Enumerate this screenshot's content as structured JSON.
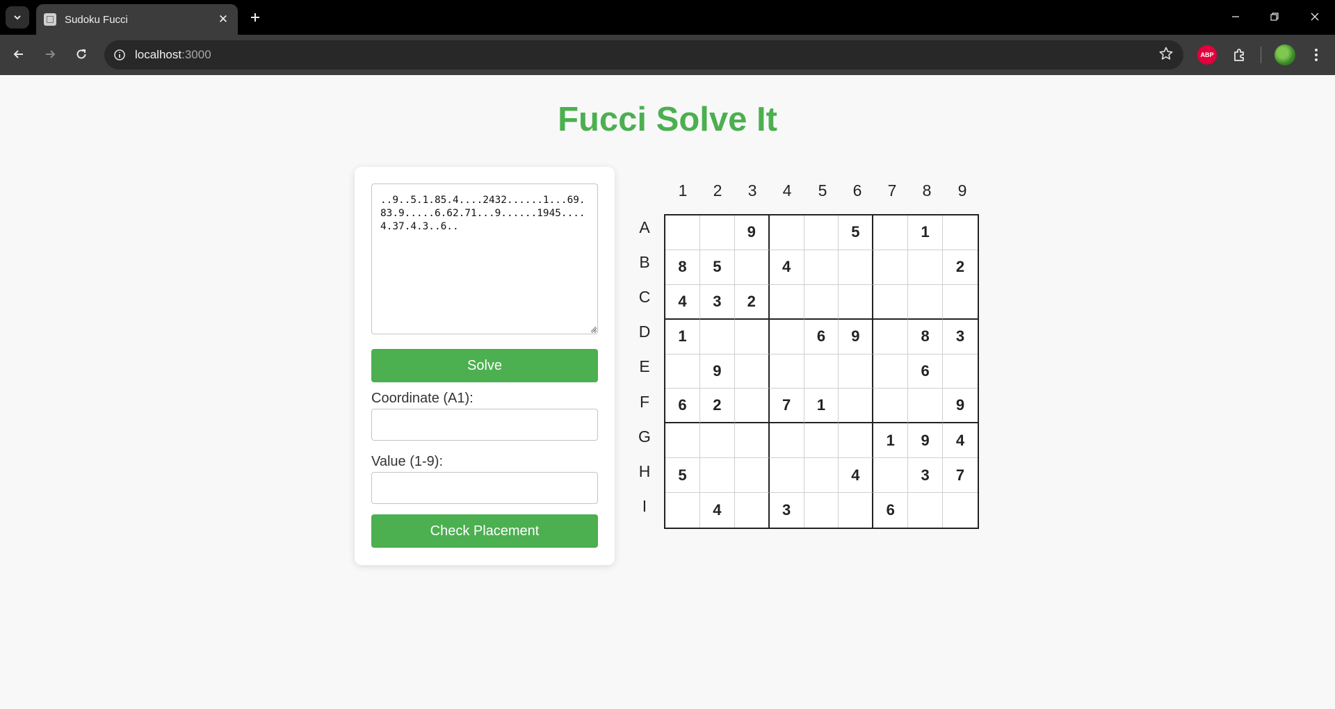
{
  "browser": {
    "tab_title": "Sudoku Fucci",
    "url_host": "localhost",
    "url_port": ":3000",
    "extension_badge": "ABP"
  },
  "page": {
    "title": "Fucci Solve It"
  },
  "form": {
    "puzzle_string": "..9..5.1.85.4....2432......1...69.83.9.....6.62.71...9......1945....4.37.4.3..6..",
    "solve_label": "Solve",
    "coordinate_label": "Coordinate (A1):",
    "coordinate_value": "",
    "value_label": "Value (1-9):",
    "value_value": "",
    "check_label": "Check Placement"
  },
  "grid": {
    "columns": [
      "1",
      "2",
      "3",
      "4",
      "5",
      "6",
      "7",
      "8",
      "9"
    ],
    "rows": [
      "A",
      "B",
      "C",
      "D",
      "E",
      "F",
      "G",
      "H",
      "I"
    ],
    "cells": [
      [
        "",
        "",
        "9",
        "",
        "",
        "5",
        "",
        "1",
        ""
      ],
      [
        "8",
        "5",
        "",
        "4",
        "",
        "",
        "",
        "",
        "2"
      ],
      [
        "4",
        "3",
        "2",
        "",
        "",
        "",
        "",
        "",
        ""
      ],
      [
        "1",
        "",
        "",
        "",
        "6",
        "9",
        "",
        "8",
        "3"
      ],
      [
        "",
        "9",
        "",
        "",
        "",
        "",
        "",
        "6",
        ""
      ],
      [
        "6",
        "2",
        "",
        "7",
        "1",
        "",
        "",
        "",
        "9"
      ],
      [
        "",
        "",
        "",
        "",
        "",
        "",
        "1",
        "9",
        "4"
      ],
      [
        "5",
        "",
        "",
        "",
        "",
        "4",
        "",
        "3",
        "7"
      ],
      [
        "",
        "4",
        "",
        "3",
        "",
        "",
        "6",
        "",
        ""
      ]
    ]
  }
}
